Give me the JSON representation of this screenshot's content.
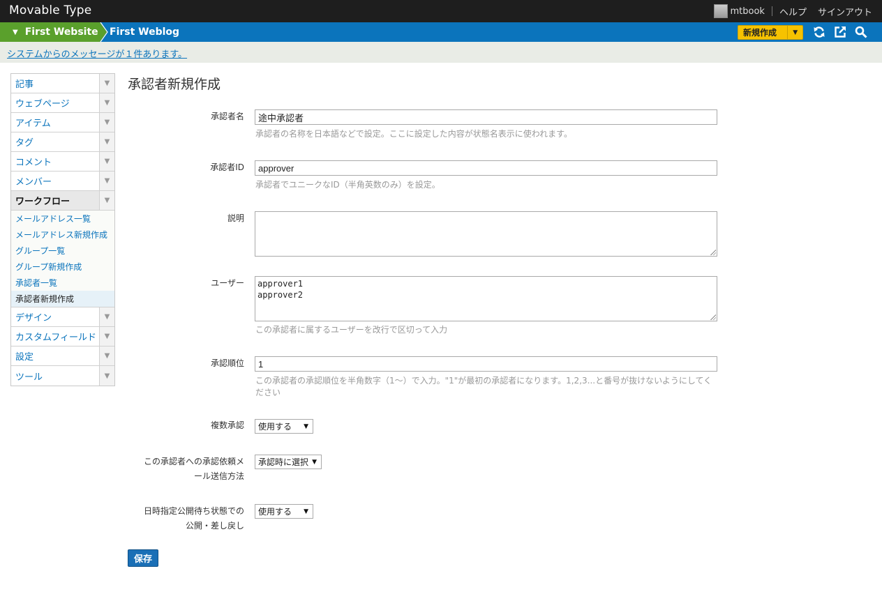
{
  "app": {
    "title": "Movable Type"
  },
  "user": {
    "name": "mtbook",
    "help": "ヘルプ",
    "signout": "サインアウト"
  },
  "sitebar": {
    "website": "First Website",
    "weblog": "First Weblog",
    "new_label": "新規作成"
  },
  "message": {
    "text": "システムからのメッセージが１件あります。"
  },
  "sidebar": {
    "items_top": [
      "記事",
      "ウェブページ",
      "アイテム",
      "タグ",
      "コメント",
      "メンバー"
    ],
    "workflow": "ワークフロー",
    "sub_items": [
      "メールアドレス一覧",
      "メールアドレス新規作成",
      "グループ一覧",
      "グループ新規作成",
      "承認者一覧",
      "承認者新規作成"
    ],
    "items_bottom": [
      "デザイン",
      "カスタムフィールド",
      "設定",
      "ツール"
    ]
  },
  "page": {
    "title": "承認者新規作成"
  },
  "form": {
    "name_label": "承認者名",
    "name_value": "途中承認者",
    "name_hint": "承認者の名称を日本語などで設定。ここに設定した内容が状態名表示に使われます。",
    "id_label": "承認者ID",
    "id_value": "approver",
    "id_hint": "承認者でユニークなID（半角英数のみ）を設定。",
    "desc_label": "説明",
    "desc_value": "",
    "users_label": "ユーザー",
    "users_value": "approver1\napprover2",
    "users_hint": "この承認者に属するユーザーを改行で区切って入力",
    "order_label": "承認順位",
    "order_value": "1",
    "order_hint": "この承認者の承認順位を半角数字（1〜）で入力。\"1\"が最初の承認者になります。1,2,3...と番号が抜けないようにしてください",
    "multi_label": "複数承認",
    "multi_value": "使用する",
    "mail_label_1": "この承認者への承認依頼メ",
    "mail_label_2": "ール送信方法",
    "mail_value": "承認時に選択",
    "scheduled_label_1": "日時指定公開待ち状態での",
    "scheduled_label_2": "公開・差し戻し",
    "scheduled_value": "使用する",
    "save": "保存"
  }
}
